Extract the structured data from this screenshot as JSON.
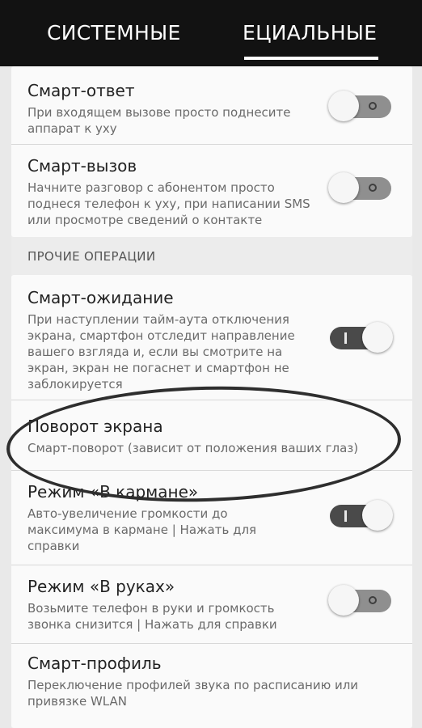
{
  "tabs": [
    {
      "label": "СИСТЕМНЫЕ"
    },
    {
      "label": "ЕЦИАЛЬНЫЕ"
    }
  ],
  "card1": [
    {
      "title": "Смарт-ответ",
      "description": "При входящем вызове просто поднесите аппарат к уху",
      "toggle": "off"
    },
    {
      "title": "Смарт-вызов",
      "description": "Начните разговор с абонентом просто поднеся телефон к уху, при написании SMS или просмотре сведений о контакте",
      "toggle": "off"
    }
  ],
  "section_label": "ПРОЧИЕ ОПЕРАЦИИ",
  "card2": [
    {
      "title": "Смарт-ожидание",
      "description": "При наступлении тайм-аута отключения экрана, смартфон отследит направление вашего взгляда и, если вы смотрите на экран, экран не погаснет и смартфон не заблокируется",
      "toggle": "on"
    },
    {
      "title": "Поворот экрана",
      "description": "Смарт-поворот (зависит от положения ваших глаз)"
    },
    {
      "title": "Режим «В кармане»",
      "description": "Авто-увеличение громкости до максимума в кармане | Нажать для справки",
      "toggle": "on"
    },
    {
      "title": "Режим «В руках»",
      "description": "Возьмите телефон в руки и громкость звонка снизится | Нажать для справки",
      "toggle": "off"
    },
    {
      "title": "Смарт-профиль",
      "description": "Переключение профилей звука по расписанию или привязке WLAN"
    }
  ]
}
